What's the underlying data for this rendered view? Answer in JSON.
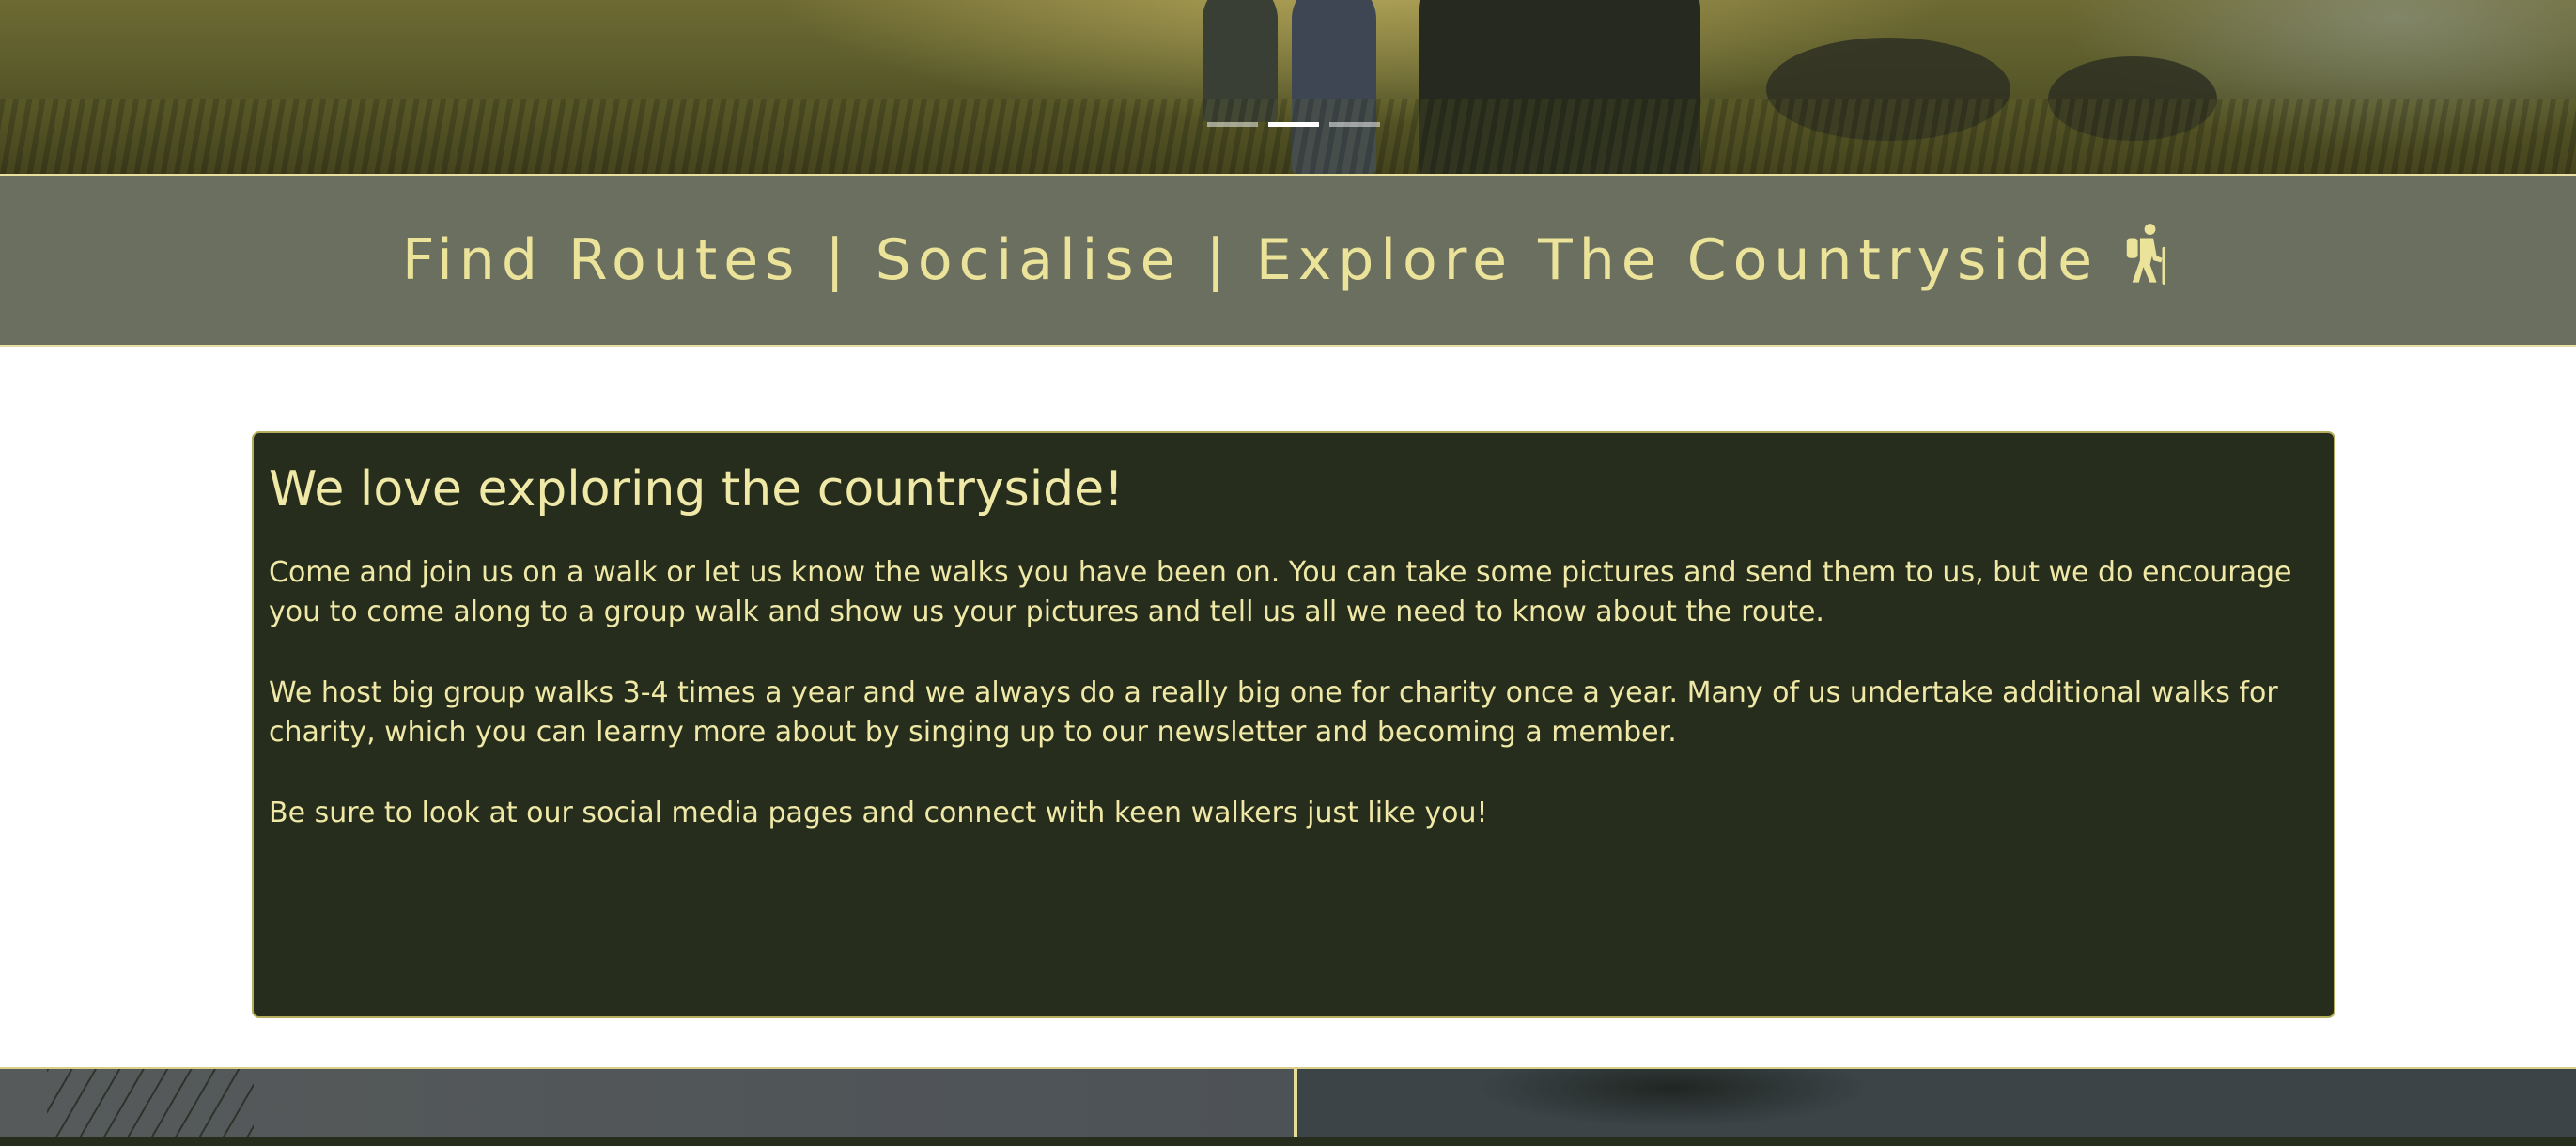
{
  "hero": {
    "slides": [
      "slide-1",
      "slide-2",
      "slide-3"
    ],
    "active_slide": 2
  },
  "tagline": {
    "text": "Find Routes | Socialise | Explore The Countryside",
    "icon": "hiking-icon"
  },
  "intro": {
    "heading": "We love exploring the countryside!",
    "paragraphs": [
      "Come and join us on a walk or let us know the walks you have been on. You can take some pictures and send them to us, but we do encourage you to come along to a group walk and show us your pictures and tell us all we need to know about the route.",
      "We host big group walks 3-4 times a year and we always do a really big one for charity once a year. Many of us undertake additional walks for charity, which you can learny more about by singing up to our newsletter and becoming a member.",
      "Be sure to look at our social media pages and connect with keen walkers just like you!"
    ]
  },
  "colors": {
    "accent_text": "#efe8a6",
    "tagline_bg": "#6b6f5f",
    "card_bg": "#262d1c",
    "border": "#e8dfa0"
  }
}
